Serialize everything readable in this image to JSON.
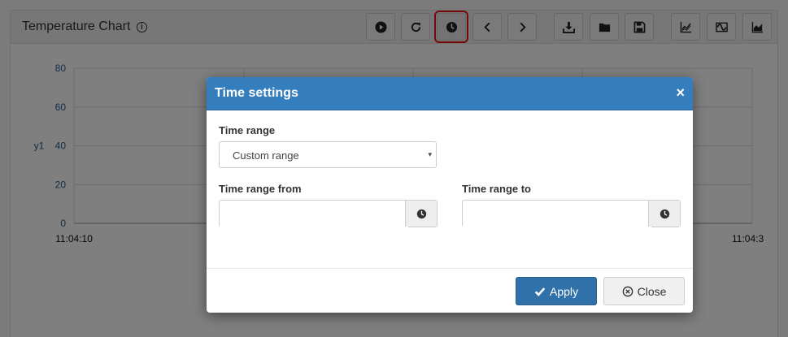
{
  "panel": {
    "title": "Temperature Chart",
    "info_icon": "info-icon",
    "toolbar": [
      {
        "name": "play-button",
        "icon": "play-icon"
      },
      {
        "name": "refresh-button",
        "icon": "refresh-icon"
      },
      {
        "name": "time-settings-button",
        "icon": "clock-icon",
        "active": true
      },
      {
        "name": "previous-button",
        "icon": "chevron-left-icon"
      },
      {
        "name": "next-button",
        "icon": "chevron-right-icon"
      },
      {
        "name": "download-button",
        "icon": "download-icon"
      },
      {
        "name": "open-button",
        "icon": "folder-icon"
      },
      {
        "name": "save-button",
        "icon": "floppy-disk-icon"
      },
      {
        "name": "line-chart-button",
        "icon": "line-chart-icon"
      },
      {
        "name": "wave-button",
        "icon": "wave-icon"
      },
      {
        "name": "area-chart-button",
        "icon": "area-chart-icon"
      }
    ]
  },
  "chart_data": {
    "type": "line",
    "ylabel": "y1",
    "ylim": [
      0,
      80
    ],
    "yticks": [
      "0",
      "20",
      "40",
      "60",
      "80"
    ],
    "xticks": [
      "11:04:10",
      "11:04:3"
    ],
    "series": [],
    "grid": true
  },
  "modal": {
    "title": "Time settings",
    "close_glyph": "×",
    "time_range_label": "Time range",
    "time_range_value": "Custom range",
    "time_range_caret": "▾",
    "from_label": "Time range from",
    "to_label": "Time range to",
    "from_value": "",
    "to_value": "",
    "apply_label": "Apply",
    "close_label": "Close"
  },
  "colors": {
    "accent": "#357ebd",
    "highlight": "#e11111",
    "axis_text": "#2a5a8c"
  }
}
